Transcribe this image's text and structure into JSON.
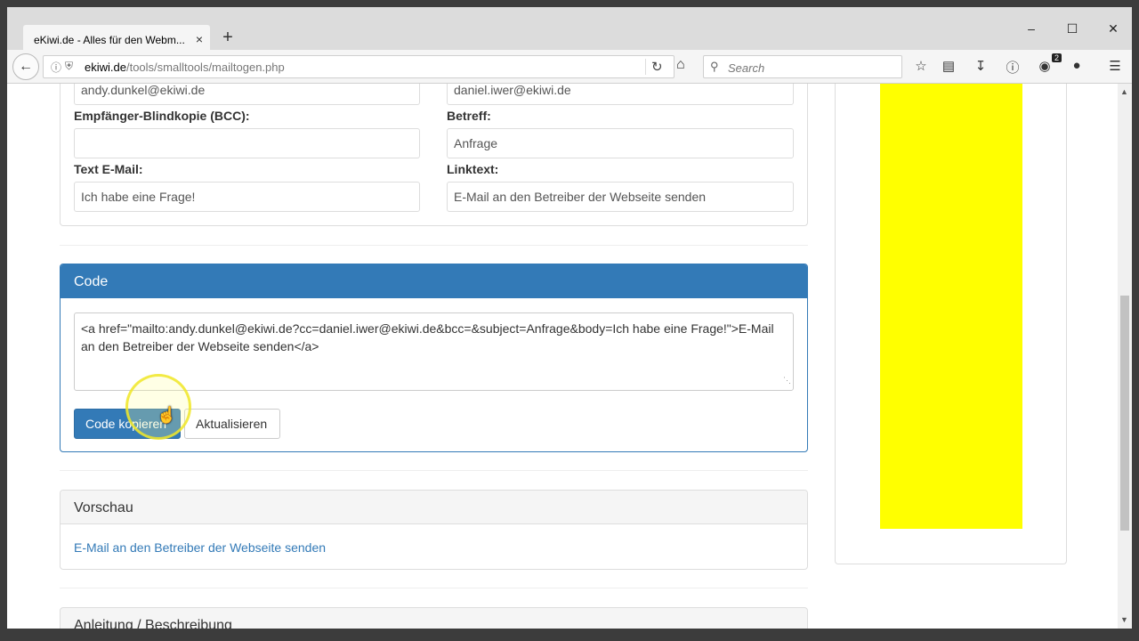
{
  "browser": {
    "tab_title": "eKiwi.de - Alles für den Webm...",
    "tab_close": "×",
    "new_tab": "+",
    "window_controls": [
      "–",
      "☐",
      "✕"
    ],
    "url_host": "ekiwi.de",
    "url_path": "/tools/smalltools/mailtogen.php",
    "search_placeholder": "Search",
    "notification_count": "2"
  },
  "form": {
    "to_value": "andy.dunkel@ekiwi.de",
    "cc_value": "daniel.iwer@ekiwi.de",
    "bcc_label": "Empfänger-Blindkopie (BCC):",
    "bcc_value": "",
    "subject_label": "Betreff:",
    "subject_value": "Anfrage",
    "body_label": "Text E-Mail:",
    "body_value": "Ich habe eine Frage!",
    "linktext_label": "Linktext:",
    "linktext_value": "E-Mail an den Betreiber der Webseite senden"
  },
  "code_panel": {
    "title": "Code",
    "code_line1": "<a href=\"mailto:andy.dunkel@ekiwi.de?cc=daniel.iwer@ekiwi.de&bcc=&subject=Anfrage&body=Ich habe eine Frage!\">E-Mail",
    "code_line2": "an den Betreiber der Webseite senden</a>",
    "copy_button": "Code kopieren",
    "refresh_button": "Aktualisieren"
  },
  "preview_panel": {
    "title": "Vorschau",
    "link_text": "E-Mail an den Betreiber der Webseite senden"
  },
  "guide_panel": {
    "title": "Anleitung / Beschreibung"
  },
  "colors": {
    "primary": "#337ab7",
    "ad_yellow": "#ffff00"
  }
}
